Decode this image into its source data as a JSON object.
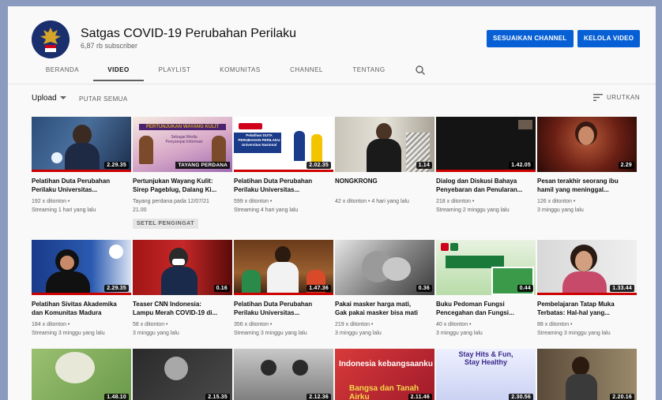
{
  "channel": {
    "name": "Satgas COVID-19 Perubahan Perilaku",
    "subscribers": "6,87 rb subscriber",
    "customize_label": "SESUAIKAN CHANNEL",
    "manage_label": "KELOLA VIDEO"
  },
  "tabs": [
    "BERANDA",
    "VIDEO",
    "PLAYLIST",
    "KOMUNITAS",
    "CHANNEL",
    "TENTANG"
  ],
  "active_tab": "VIDEO",
  "toolbar": {
    "upload_label": "Upload",
    "play_all_label": "PUTAR SEMUA",
    "sort_label": "URUTKAN"
  },
  "colors": {
    "accent": "#065fd4",
    "progress": "#cc0000"
  },
  "videos": [
    {
      "title": "Pelatihan Duta Perubahan\nPerilaku Universitas...",
      "meta": "192 x ditonton •\nStreaming 1 hari yang lalu",
      "duration": "2.29.35",
      "progress": 1.0
    },
    {
      "title": "Pertunjukan Wayang Kulit:\nSirep Pageblug, Dalang Ki...",
      "meta": "Tayang perdana pada 12/07/21\n21.00",
      "badge": "TAYANG PERDANA",
      "reminder": "SETEL PENGINGAT",
      "overlay_title": "PERTUNJUKAN WAYANG KULIT",
      "overlay_sub": "Sebagai Media\nPenyampai Informasi"
    },
    {
      "title": "Pelatihan Duta Perubahan\nPerilaku Universitas...",
      "meta": "599 x ditonton •\nStreaming 4 hari yang lalu",
      "duration": "2.02.35",
      "progress": 1.0,
      "overlay_title": "Pelatihan DUTA\nPERUBAHAN PERILAKU\nUniversitas Nasional"
    },
    {
      "title": "NONGKRONG",
      "meta": "42 x ditonton • 4 hari yang lalu",
      "duration": "1.14"
    },
    {
      "title": "Dialog dan Diskusi Bahaya\nPenyebaran dan Penularan...",
      "meta": "218 x ditonton •\nStreaming 2 minggu yang lalu",
      "duration": "1.42.05",
      "progress": 1.0
    },
    {
      "title": "Pesan terakhir seorang ibu\nhamil yang meninggal...",
      "meta": "126 x ditonton •\n3 minggu yang lalu",
      "duration": "2.29"
    },
    {
      "title": "Pelatihan Sivitas Akademika\ndan Komunitas Madura",
      "meta": "184 x ditonton •\nStreaming 3 minggu yang lalu",
      "duration": "2.29.35",
      "progress": 1.0
    },
    {
      "title": "Teaser CNN Indonesia:\nLampu Merah COVID-19 di...",
      "meta": "58 x ditonton •\n3 minggu yang lalu",
      "duration": "0.16"
    },
    {
      "title": "Pelatihan Duta Perubahan\nPerilaku Universitas...",
      "meta": "356 x ditonton •\nStreaming 3 minggu yang lalu",
      "duration": "1.47.36",
      "progress": 1.0
    },
    {
      "title": "Pakai masker harga mati,\nGak pakai masker bisa mati",
      "meta": "219 x ditonton •\n3 minggu yang lalu",
      "duration": "0.36"
    },
    {
      "title": "Buku Pedoman Fungsi\nPencegahan dan Fungsi...",
      "meta": "40 x ditonton •\n3 minggu yang lalu",
      "duration": "0.44"
    },
    {
      "title": "Pembelajaran Tatap Muka\nTerbatas: Hal-hal yang...",
      "meta": "88 x ditonton •\nStreaming 3 minggu yang lalu",
      "duration": "1.33.44",
      "progress": 1.0
    },
    {
      "duration": "1.48.10"
    },
    {
      "duration": "2.15.35"
    },
    {
      "duration": "2.12.36"
    },
    {
      "duration": "2.11.46",
      "overlay_title": "Indonesia kebangsaanku",
      "overlay_sub": "Bangsa dan Tanah Airku"
    },
    {
      "duration": "2.30.56",
      "overlay_title": "Stay Hits & Fun,\nStay Healthy"
    },
    {
      "duration": "2.20.16"
    }
  ]
}
